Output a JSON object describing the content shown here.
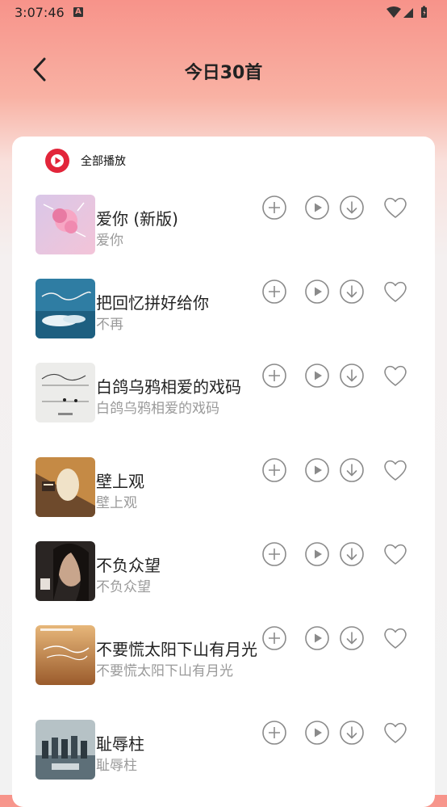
{
  "status_bar": {
    "time": "3:07:46",
    "notif_letter": "A"
  },
  "header": {
    "title": "今日30首"
  },
  "play_all": {
    "label": "全部播放"
  },
  "colors": {
    "accent": "#e2253a",
    "icon_gray": "#8a8a8a"
  },
  "songs": [
    {
      "title": "爱你 (新版)",
      "artist": "爱你"
    },
    {
      "title": "把回忆拼好给你",
      "artist": "不再"
    },
    {
      "title": "白鸽乌鸦相爱的戏码",
      "artist": "白鸽乌鸦相爱的戏码"
    },
    {
      "title": "壁上观",
      "artist": "壁上观"
    },
    {
      "title": "不负众望",
      "artist": "不负众望"
    },
    {
      "title": "不要慌太阳下山有月光",
      "artist": "不要慌太阳下山有月光"
    },
    {
      "title": "耻辱柱",
      "artist": "耻辱柱"
    }
  ],
  "row_icons": [
    "add-icon",
    "play-icon",
    "download-icon",
    "heart-icon"
  ]
}
